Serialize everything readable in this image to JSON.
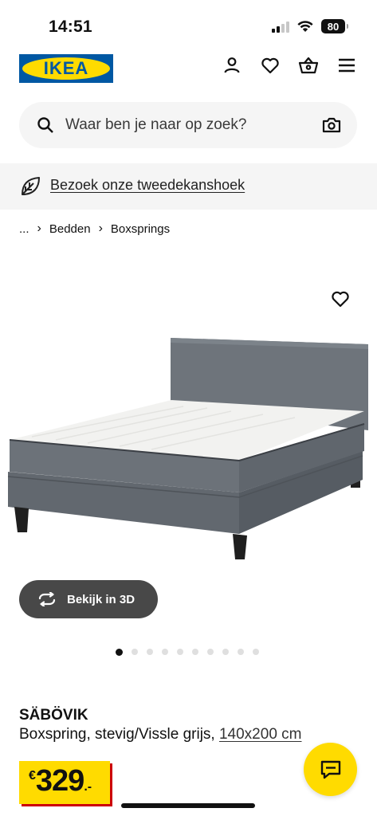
{
  "status_bar": {
    "time": "14:51",
    "battery": "80"
  },
  "header": {
    "logo_text": "IKEA",
    "icons": [
      "account-icon",
      "heart-icon",
      "basket-icon",
      "menu-icon"
    ]
  },
  "search": {
    "placeholder": "Waar ben je naar op zoek?"
  },
  "banner": {
    "link_text": "Bezoek onze tweedekanshoek"
  },
  "breadcrumb": {
    "items": [
      "...",
      "Bedden",
      "Boxsprings"
    ]
  },
  "gallery": {
    "view_3d_label": "Bekijk in 3D",
    "dot_count": 10,
    "active_dot": 0
  },
  "product": {
    "name": "SÄBÖVIK",
    "description": "Boxspring, stevig/Vissle grijs,",
    "size": "140x200 cm",
    "price": {
      "currency": "€",
      "amount": "329",
      "decimal": ".-"
    }
  },
  "colors": {
    "ikea_blue": "#0058a3",
    "ikea_yellow": "#ffdb00",
    "price_shadow_red": "#cc0008",
    "bed_fabric": "#6f757c"
  }
}
